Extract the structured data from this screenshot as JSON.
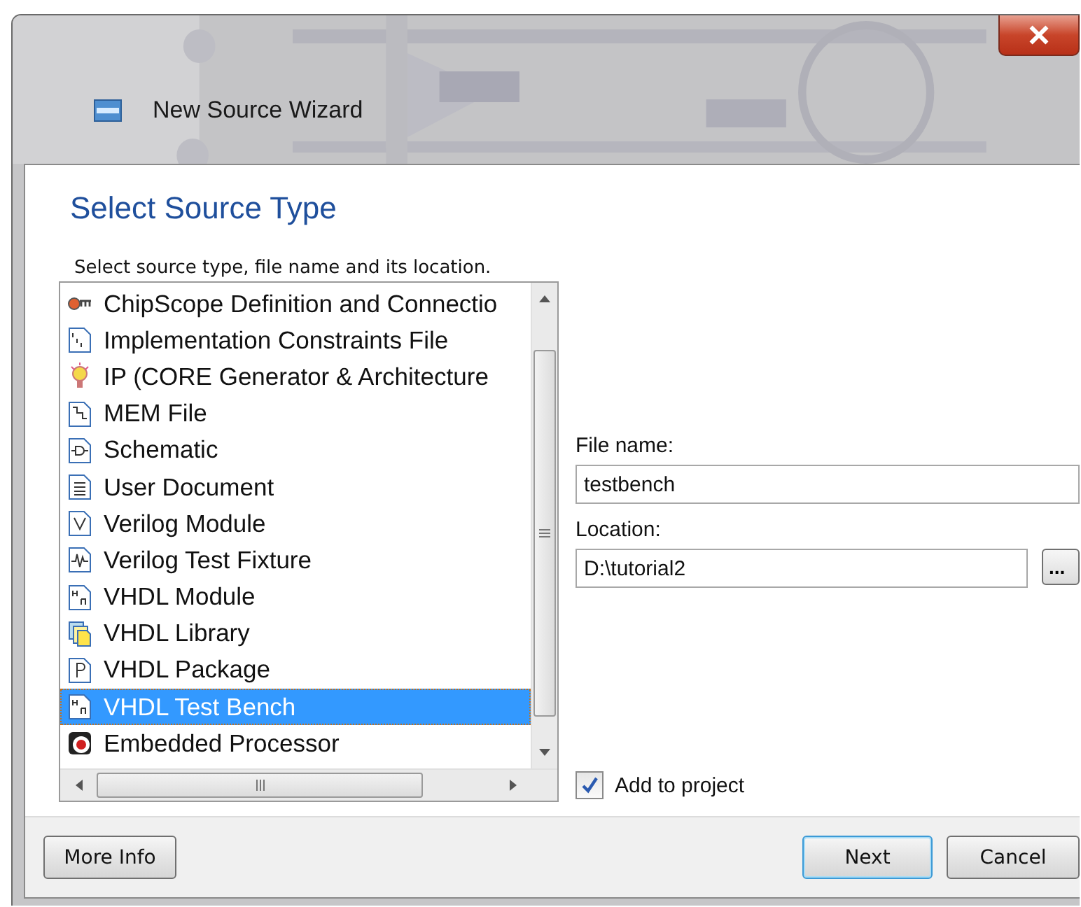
{
  "window": {
    "title": "New Source Wizard"
  },
  "heading": "Select Source Type",
  "instruction": "Select source type, file name and its location.",
  "source_types": [
    {
      "label": "ChipScope Definition and Connectio",
      "selected": false
    },
    {
      "label": "Implementation Constraints File",
      "selected": false
    },
    {
      "label": "IP (CORE Generator & Architecture",
      "selected": false
    },
    {
      "label": "MEM File",
      "selected": false
    },
    {
      "label": "Schematic",
      "selected": false
    },
    {
      "label": "User Document",
      "selected": false
    },
    {
      "label": "Verilog Module",
      "selected": false
    },
    {
      "label": "Verilog Test Fixture",
      "selected": false
    },
    {
      "label": "VHDL Module",
      "selected": false
    },
    {
      "label": "VHDL Library",
      "selected": false
    },
    {
      "label": "VHDL Package",
      "selected": false
    },
    {
      "label": "VHDL Test Bench",
      "selected": true
    },
    {
      "label": "Embedded Processor",
      "selected": false
    }
  ],
  "file_name": {
    "label": "File name:",
    "value": "testbench"
  },
  "location": {
    "label": "Location:",
    "value": "D:\\tutorial2",
    "browse": "..."
  },
  "add_to_project": {
    "label": "Add to project",
    "checked": true
  },
  "buttons": [
    {
      "label": "More Info",
      "default": false
    },
    {
      "label": "Next",
      "default": true
    },
    {
      "label": "Cancel",
      "default": false
    }
  ]
}
